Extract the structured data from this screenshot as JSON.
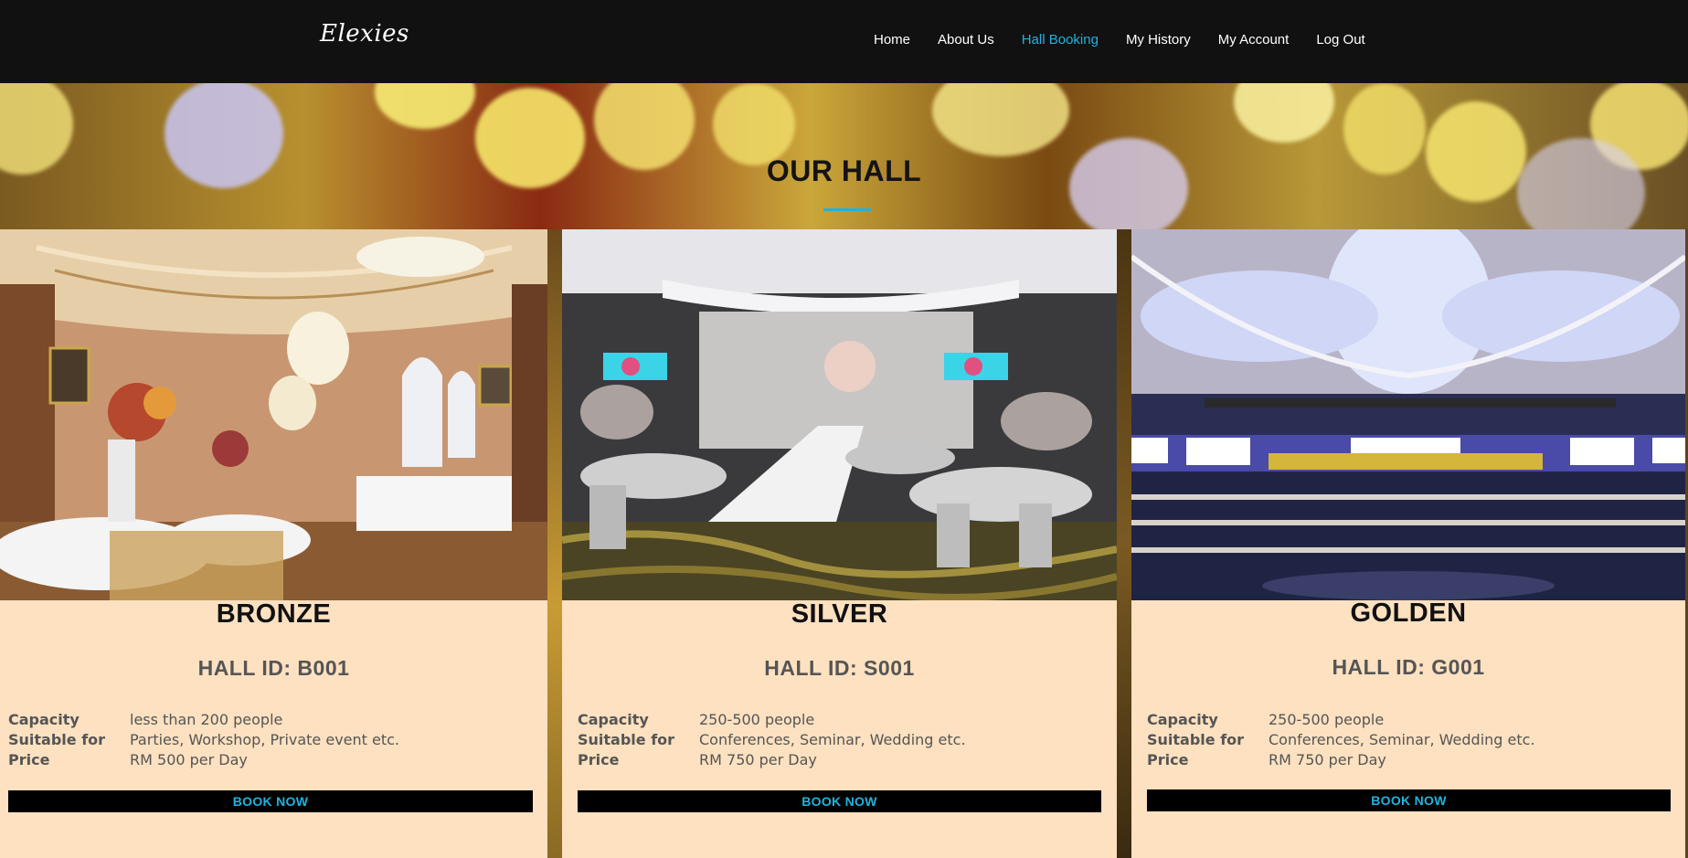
{
  "brand": {
    "logo_text": "Elexies"
  },
  "nav": {
    "items": [
      {
        "label": "Home"
      },
      {
        "label": "About Us"
      },
      {
        "label": "Hall Booking",
        "active": true
      },
      {
        "label": "My History"
      },
      {
        "label": "My Account"
      },
      {
        "label": "Log Out"
      }
    ]
  },
  "hero": {
    "title": "OUR HALL"
  },
  "colors": {
    "accent": "#21b2de",
    "card_bg": "#fde1c0",
    "nav_bg": "#111111"
  },
  "halls": [
    {
      "name": "BRONZE",
      "id_line": "HALL ID: B001",
      "specs": [
        {
          "key": "Capacity",
          "value": "less than 200 people"
        },
        {
          "key": "Suitable for",
          "value": "Parties, Workshop, Private event etc."
        },
        {
          "key": "Price",
          "value": "RM 500 per Day"
        }
      ],
      "button": "BOOK NOW"
    },
    {
      "name": "SILVER",
      "id_line": "HALL ID: S001",
      "specs": [
        {
          "key": "Capacity",
          "value": "250-500 people"
        },
        {
          "key": "Suitable for",
          "value": "Conferences, Seminar, Wedding etc."
        },
        {
          "key": "Price",
          "value": "RM 750 per Day"
        }
      ],
      "button": "BOOK NOW"
    },
    {
      "name": "GOLDEN",
      "id_line": "HALL ID: G001",
      "specs": [
        {
          "key": "Capacity",
          "value": "250-500 people"
        },
        {
          "key": "Suitable for",
          "value": "Conferences, Seminar, Wedding etc."
        },
        {
          "key": "Price",
          "value": "RM 750 per Day"
        }
      ],
      "button": "BOOK NOW"
    }
  ]
}
